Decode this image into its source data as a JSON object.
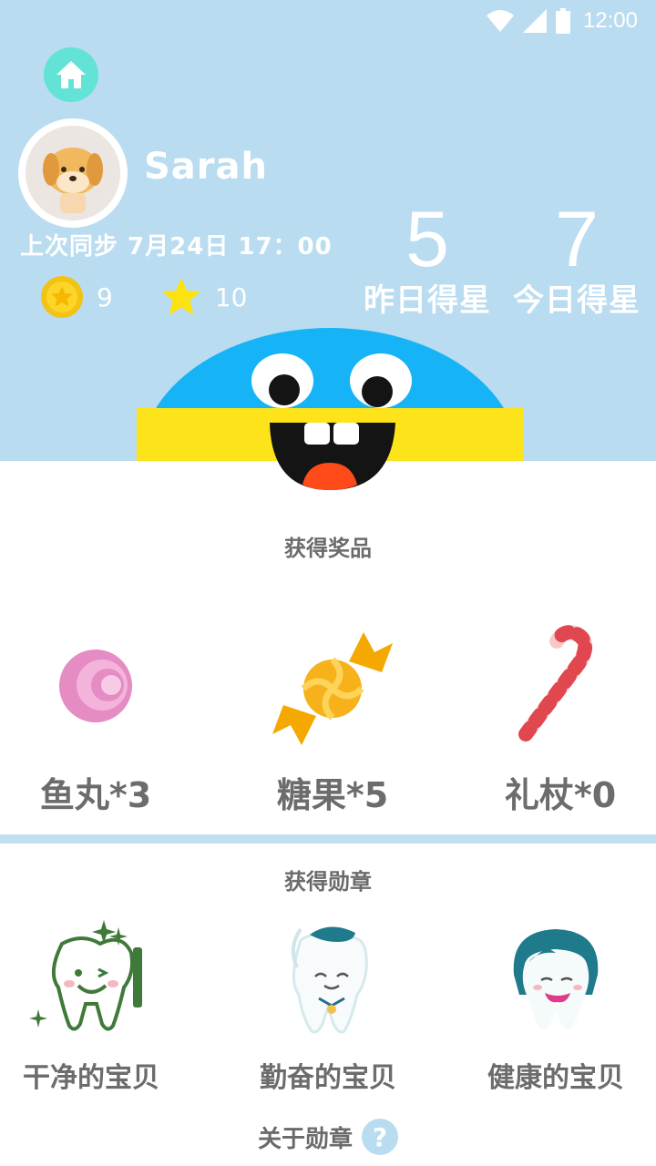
{
  "status_bar": {
    "time": "12:00"
  },
  "profile": {
    "name": "Sarah",
    "sync_text": "上次同步 7月24日 17：00",
    "coins": "9",
    "stars": "10"
  },
  "scores": {
    "yesterday": {
      "value": "5",
      "label": "昨日得星"
    },
    "today": {
      "value": "7",
      "label": "今日得星"
    }
  },
  "prizes": {
    "title": "获得奖品",
    "items": [
      {
        "label": "鱼丸*3",
        "icon": "pink-ball-icon"
      },
      {
        "label": "糖果*5",
        "icon": "candy-icon"
      },
      {
        "label": "礼杖*0",
        "icon": "candy-cane-icon"
      }
    ]
  },
  "badges": {
    "title": "获得勋章",
    "items": [
      {
        "label": "干净的宝贝",
        "icon": "clean-tooth-icon"
      },
      {
        "label": "勤奋的宝贝",
        "icon": "diligent-tooth-icon"
      },
      {
        "label": "健康的宝贝",
        "icon": "healthy-tooth-icon"
      }
    ],
    "about_label": "关于勋章"
  },
  "colors": {
    "header_bg": "#b9dcf0",
    "home_button": "#62e3d5",
    "monster_blue": "#16b3f7",
    "monster_yellow": "#fde319",
    "text_gray": "#6c6c6c"
  }
}
